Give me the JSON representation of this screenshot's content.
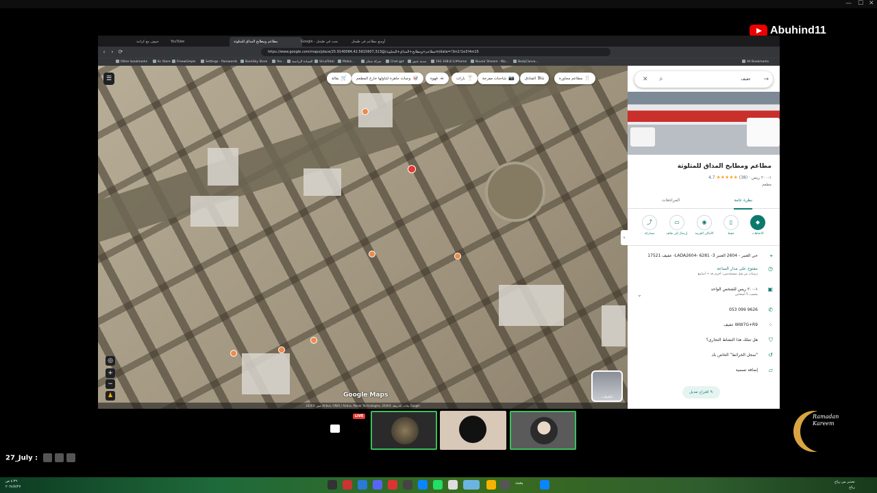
{
  "channel": {
    "name": "Abuhind11"
  },
  "browser": {
    "tabs": [
      {
        "label": "جيوف مع كراتية"
      },
      {
        "label": "YouTube"
      },
      {
        "label": "مطاعم ومطابخ المذاق للمثلوثة"
      },
      {
        "label": "Google - بحث في طيحل"
      },
      {
        "label": "أوسع مطاعم في طيحل"
      }
    ],
    "url": "https://www.google.com/maps/place/مطاعم+ومطابخ+المذاق+للمثلوثة/@25.9140084,42.5615607,313m/data=!3m1!1e3!4m15",
    "bookmarks": [
      "Other bookmarks",
      "Kc Store",
      "FreewGmpls",
      "Settings - Passwords",
      "BackSky Store",
      "Yes...",
      "السيادة الرياضية",
      "VirusTotal",
      "Mobis...",
      "شركة مبتكر",
      "Chat gpt",
      "صدية عنيق",
      "192.168.8.1/#home",
      "Nuvoir Stream - Wa...",
      "BodyCanva...",
      "All Bookmarks"
    ]
  },
  "map": {
    "chips": [
      {
        "label": "مطاعم مجاورة",
        "icon": "🍴"
      },
      {
        "label": "الفنادق",
        "icon": "🛏"
      },
      {
        "label": "شاحنات مفرحة",
        "icon": "📷"
      },
      {
        "label": "بارات",
        "icon": "🍸"
      },
      {
        "label": "قهوة",
        "icon": "☕"
      },
      {
        "label": "وجبات جاهزة لتناولها خارج المطعم",
        "icon": "🥡"
      },
      {
        "label": "بقالة",
        "icon": "🛒"
      }
    ],
    "logo": "Google Maps",
    "attribution": "صور ©2026 Airbus, CNES / Airbus, Maxar Technologies, بيانات الخريطة ©2026 Google",
    "layers_label": "الطبقات"
  },
  "place": {
    "search_text": "عفيف",
    "name": "مطاعم ومطابخ المذاق للمثلوثة",
    "rating": "4.7",
    "reviews": "(38)",
    "price": "١-٢٠٠ ريس",
    "type": "مطعم",
    "tabs": [
      "نظرة عامة",
      "المراجعات"
    ],
    "actions": [
      "الاتجاهات",
      "حفظ",
      "الأماكن القريبة",
      "إرسال إلى هاتف",
      "مشاركة"
    ],
    "address": "حي العنبر - 2604 العنبر 3- 6281 -LADA2604- عفيف 17521",
    "hours": "مفتوح على مدار الساعة",
    "hours_sub": "ترتيبات من قِبل مستخدمين: أخرى قد + أسابيع",
    "price_row": "١-٢٠٠ ريس للشخص الواحد",
    "price_sub": "بحسب 5 أشخاص",
    "phone": "053 099 9626",
    "plus_code": "WW7G+R9 عفيف",
    "claim": "هل تملك هذا النشاط التجاري؟",
    "history": "\"سجل الخرائط\" الخاص بك",
    "label": "إضافة تسمية",
    "suggest": "اقتراح تعديل"
  },
  "call": {
    "live": "LIVE"
  },
  "overlay": {
    "date": "27_July :"
  },
  "ramadan": {
    "line1": "Ramadan",
    "line2": "Kareem"
  },
  "taskbar": {
    "time": "٤:٣٦ ص",
    "date": "٢٠٢٤/٧/٢٧",
    "search": "بحث",
    "user": "تحذير من رياح",
    "user_sub": "رياح"
  }
}
